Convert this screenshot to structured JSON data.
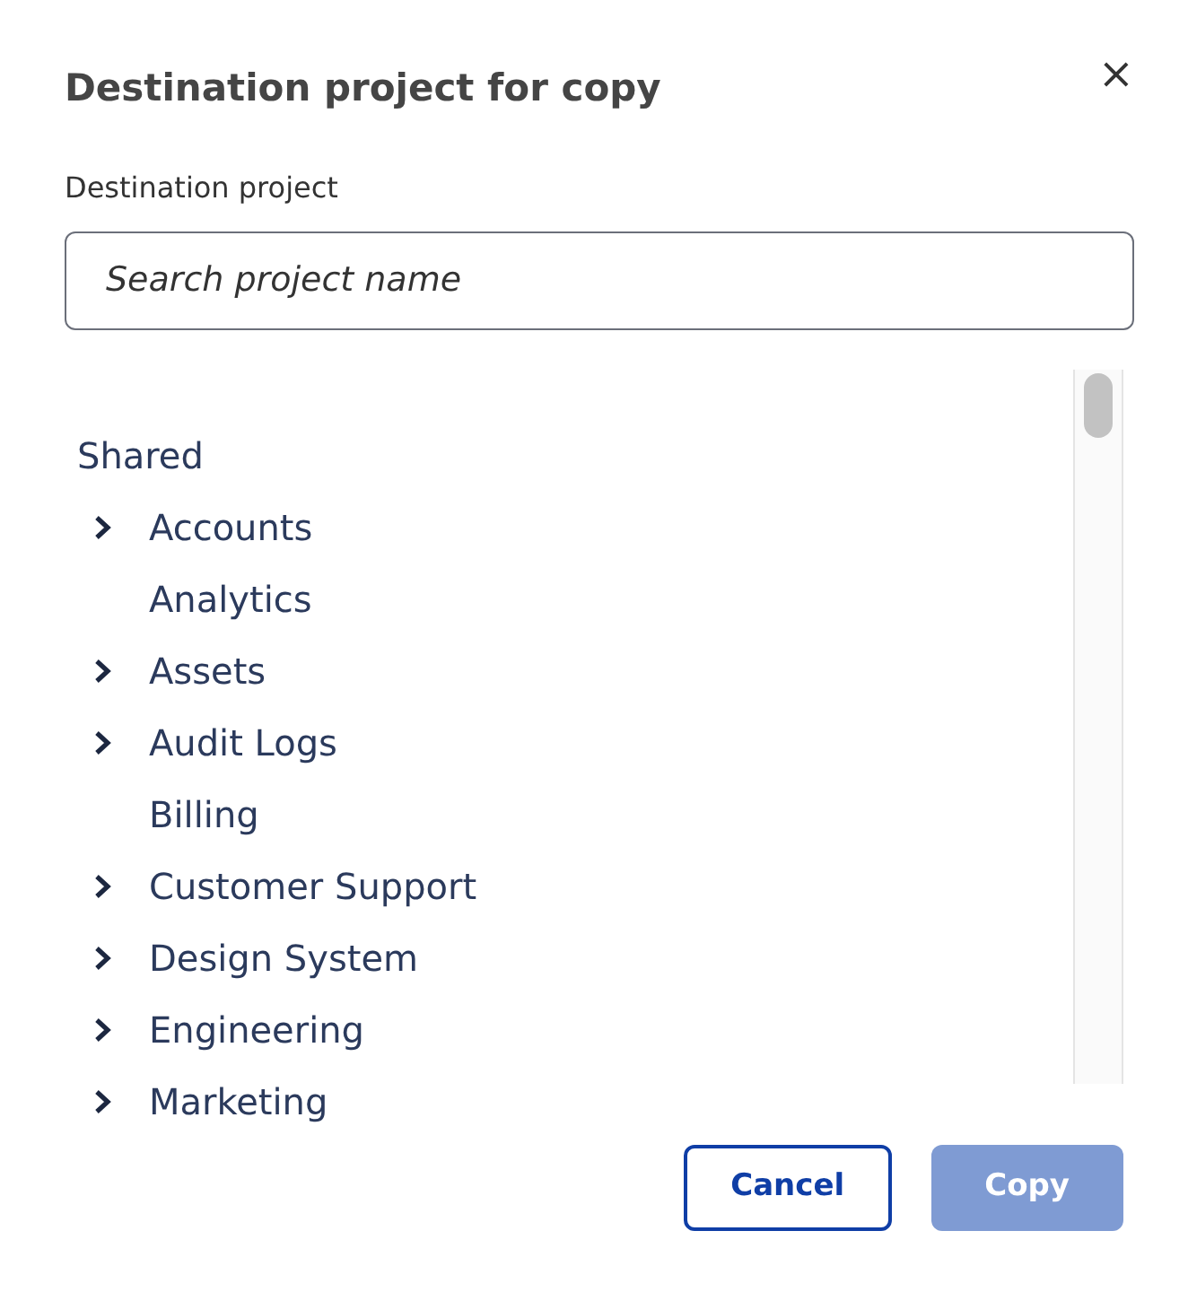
{
  "dialog": {
    "title": "Destination project for copy",
    "close": "×"
  },
  "field": {
    "label": "Destination project",
    "placeholder": "Search project name"
  },
  "tree": {
    "label": "Shared",
    "children": [
      {
        "label": "Accounts",
        "kind": "folder",
        "expanded": false
      },
      {
        "label": "Analytics",
        "kind": "leaf"
      },
      {
        "label": "Assets",
        "kind": "folder",
        "expanded": false
      },
      {
        "label": "Audit Logs",
        "kind": "folder",
        "expanded": false
      },
      {
        "label": "Billing",
        "kind": "leaf"
      },
      {
        "label": "Customer Support",
        "kind": "folder",
        "expanded": false
      },
      {
        "label": "Design System",
        "kind": "folder",
        "expanded": false
      },
      {
        "label": "Engineering",
        "kind": "folder",
        "expanded": false
      },
      {
        "label": "Marketing",
        "kind": "folder",
        "expanded": false
      }
    ]
  },
  "buttons": [
    {
      "label": "Cancel",
      "disabled": false
    },
    {
      "label": "Copy",
      "disabled": true
    }
  ]
}
